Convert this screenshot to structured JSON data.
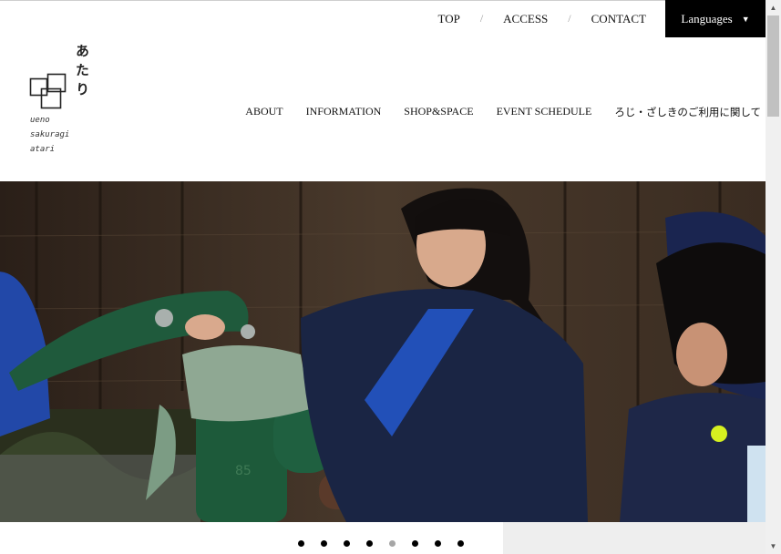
{
  "top_nav": {
    "items": [
      "TOP",
      "ACCESS",
      "CONTACT"
    ],
    "separator": "/",
    "languages_label": "Languages",
    "languages_icon": "caret-down-icon"
  },
  "logo": {
    "jp": "あたり",
    "en_lines": [
      "ueno",
      "sakuragi",
      "atari"
    ]
  },
  "main_nav": {
    "items": [
      "ABOUT",
      "INFORMATION",
      "SHOP&SPACE",
      "EVENT SCHEDULE",
      "ろじ・ざしきのご利用に関して"
    ]
  },
  "hero": {
    "description_icon": "photo-children-at-water-pump",
    "pump_number": "85"
  },
  "slider": {
    "total_slides": 8,
    "active_slide": 5
  },
  "colors": {
    "language_button_bg": "#000000",
    "active_dot": "#a6a6a6",
    "inactive_dot": "#000000"
  }
}
